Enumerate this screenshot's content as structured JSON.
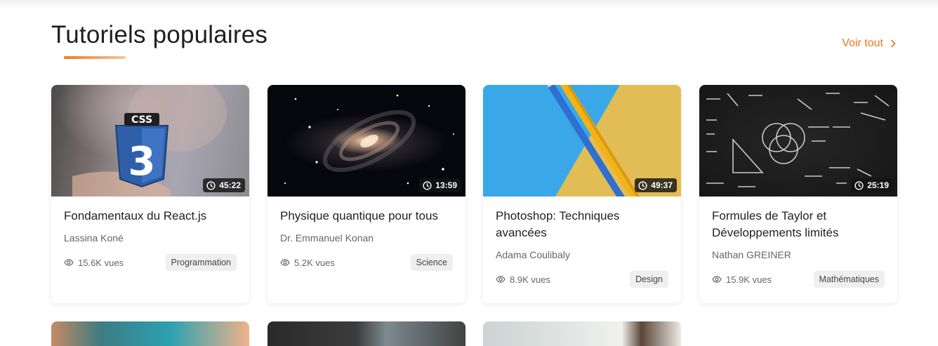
{
  "section": {
    "title": "Tutoriels populaires",
    "see_all_label": "Voir tout",
    "accent_color": "#e8781c"
  },
  "tutorials": [
    {
      "title": "Fondamentaux du React.js",
      "author": "Lassina Koné",
      "views": "15.6K vues",
      "category": "Programmation",
      "duration": "45:22",
      "thumbnail": "css3-logo-in-hand",
      "thumb_badge_top": "CSS",
      "thumb_badge_num": "3"
    },
    {
      "title": "Physique quantique pour tous",
      "author": "Dr. Emmanuel Konan",
      "views": "5.2K vues",
      "category": "Science",
      "duration": "13:59",
      "thumbnail": "spiral-galaxy"
    },
    {
      "title": "Photoshop: Techniques avancées",
      "author": "Adama Coulibaly",
      "views": "8.9K vues",
      "category": "Design",
      "duration": "49:37",
      "thumbnail": "colored-pencils"
    },
    {
      "title": "Formules de Taylor et Développements limités",
      "author": "Nathan GREINER",
      "views": "15.9K vues",
      "category": "Mathématiques",
      "duration": "25:19",
      "thumbnail": "math-chalkboard"
    }
  ],
  "next_row": [
    {
      "thumbnail": "craft-scene"
    },
    {
      "thumbnail": "office-people"
    },
    {
      "thumbnail": "person-portrait"
    }
  ]
}
